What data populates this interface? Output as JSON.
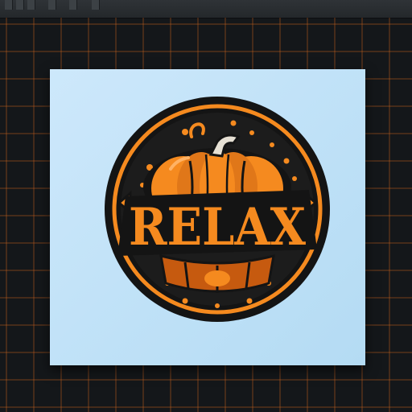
{
  "app": {
    "canvas_background": "#14171a",
    "grid_color": "#c6611d",
    "artboard_color": "#c6e4f8"
  },
  "logo": {
    "text": "RELAX",
    "subject": "pumpkin-emblem",
    "colors": {
      "orange": "#f58a1f",
      "dark_orange": "#c65a0f",
      "outline": "#141414",
      "stem": "#e6e0d4"
    }
  },
  "toolbar": {
    "tab_icon": "tool-tab-icon"
  }
}
